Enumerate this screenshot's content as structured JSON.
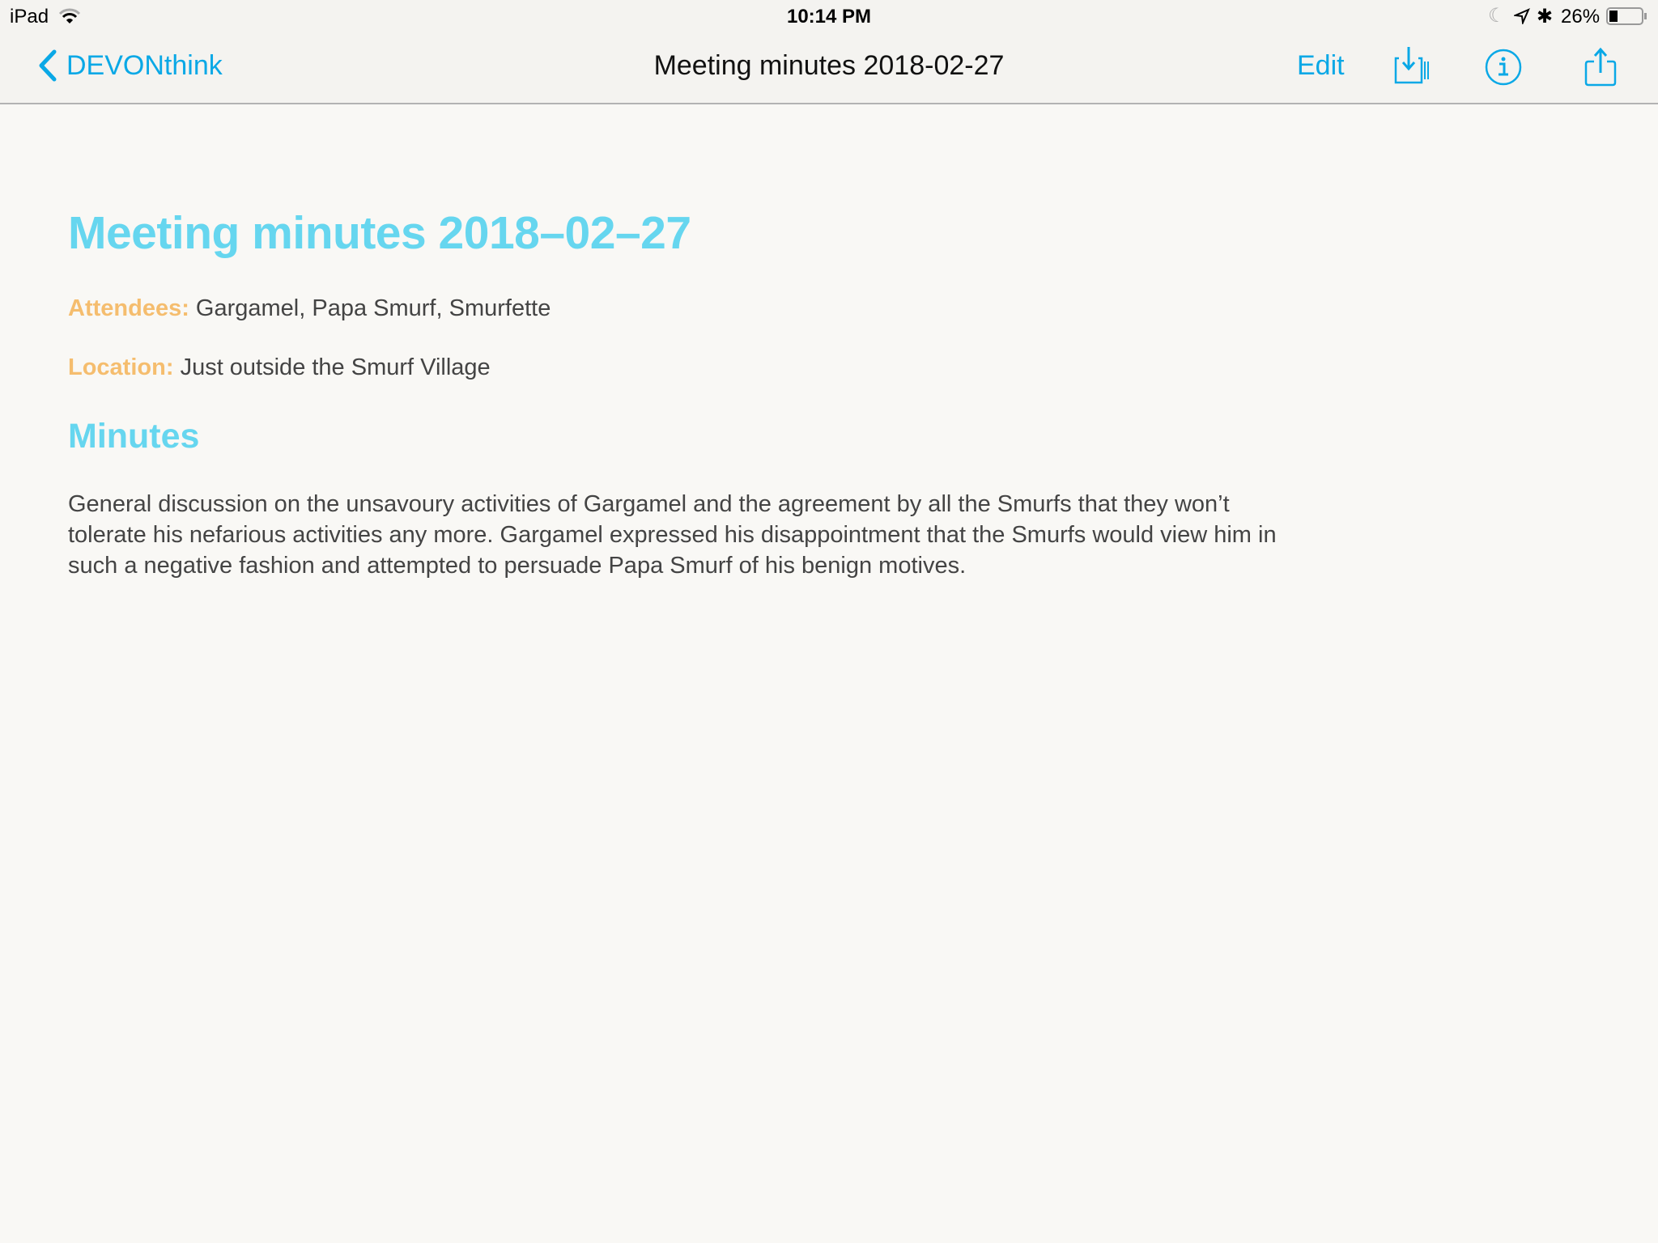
{
  "status_bar": {
    "device": "iPad",
    "time": "10:14 PM",
    "battery": "26%",
    "battery_level": 0.26
  },
  "nav": {
    "back_label": "DEVONthink",
    "title": "Meeting minutes 2018-02-27",
    "edit_label": "Edit"
  },
  "document": {
    "title": "Meeting minutes 2018–02–27",
    "attendees_label": "Attendees:",
    "attendees": "Gargamel, Papa Smurf, Smurfette",
    "location_label": "Location:",
    "location": "Just outside the Smurf Village",
    "section_heading": "Minutes",
    "paragraph_lines": [
      "General discussion on the unsavoury activities of Gargamel and the agreement by all the Smurfs that they won’t",
      "tolerate his nefarious activities any more. Gargamel expressed his disappointment that the Smurfs would view him in",
      "such a negative fashion and attempted to persuade Papa Smurf of his benign motives."
    ]
  },
  "colors": {
    "accent": "#0aa8e6",
    "heading": "#66d6ef",
    "label": "#f5bd6e",
    "text": "#444444"
  }
}
